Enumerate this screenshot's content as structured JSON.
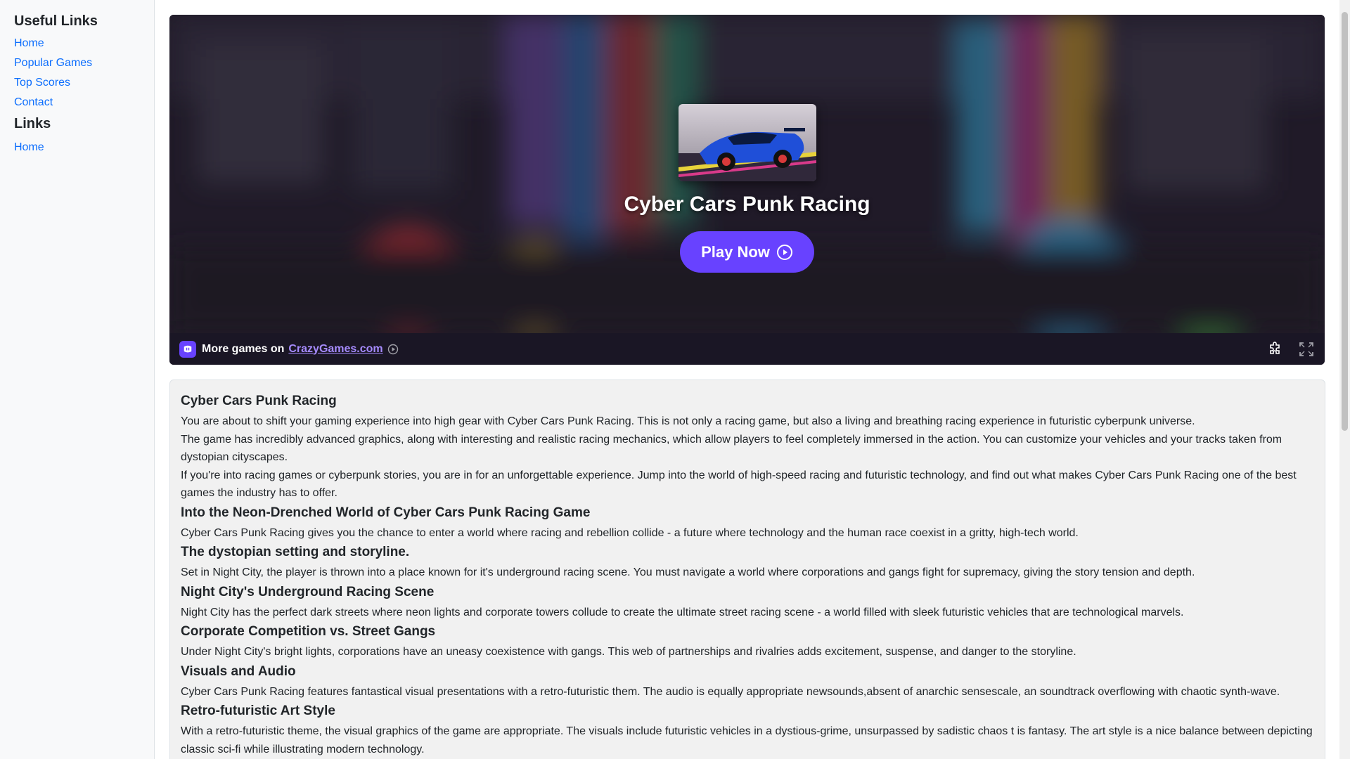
{
  "sidebar": {
    "useful_title": "Useful Links",
    "useful_links": [
      "Home",
      "Popular Games",
      "Top Scores",
      "Contact"
    ],
    "links_title": "Links",
    "links": [
      "Home"
    ]
  },
  "game": {
    "title": "Cyber Cars Punk Racing",
    "play_label": "Play Now",
    "bar_text": "More games on",
    "bar_link": "CrazyGames.com",
    "icons": {
      "play": "play-circle-icon",
      "logo": "crazygames-logo-icon",
      "external": "external-play-icon",
      "puzzle": "puzzle-icon",
      "fullscreen": "fullscreen-icon"
    },
    "accent": "#6842ff"
  },
  "article": {
    "h1": "Cyber Cars Punk Racing",
    "p1": "You are about to shift your gaming experience into high gear with Cyber Cars Punk Racing. This is not only a racing game, but also a living and breathing racing experience in futuristic cyberpunk universe.",
    "p2": "The game has incredibly advanced graphics, along with interesting and realistic racing mechanics, which allow players to feel completely immersed in the action. You can customize your vehicles and your tracks taken from dystopian cityscapes.",
    "p3": "If you're into racing games or cyberpunk stories, you are in for an unforgettable experience. Jump into the world of high-speed racing and futuristic technology, and find out what makes Cyber Cars Punk Racing one of the best games the industry has to offer.",
    "h2": "Into the Neon-Drenched World of Cyber Cars Punk Racing Game",
    "p4": "Cyber Cars Punk Racing gives you the chance to enter a world where racing and rebellion collide - a future where technology and the human race coexist in a gritty, high-tech world.",
    "h3": "The dystopian setting and storyline.",
    "p5": "Set in Night City, the player is thrown into a place known for it's underground racing scene. You must navigate a world where corporations and gangs fight for supremacy, giving the story tension and depth.",
    "h4": "Night City's Underground Racing Scene",
    "p6": "Night City has the perfect dark streets where neon lights and corporate towers collude to create the ultimate street racing scene - a world filled with sleek futuristic vehicles that are technological marvels.",
    "h5": "Corporate Competition vs. Street Gangs",
    "p7": "Under Night City's bright lights, corporations have an uneasy coexistence with gangs. This web of partnerships and rivalries adds excitement, suspense, and danger to the storyline.",
    "h6": "Visuals and Audio",
    "p8": "Cyber Cars Punk Racing features fantastical visual presentations with a retro-futuristic them. The audio is equally appropriate newsounds,absent of anarchic sensescale, an soundtrack overflowing with chaotic synth-wave.",
    "h7": "Retro-futuristic Art Style",
    "p9": "With a retro-futuristic theme, the visual graphics of the game are appropriate. The visuals include futuristic vehicles in a dystious-grime, unsurpassed by sadistic chaos t is fantasy. The art style is a nice balance between depicting classic sci-fi while illustrating modern technology."
  }
}
